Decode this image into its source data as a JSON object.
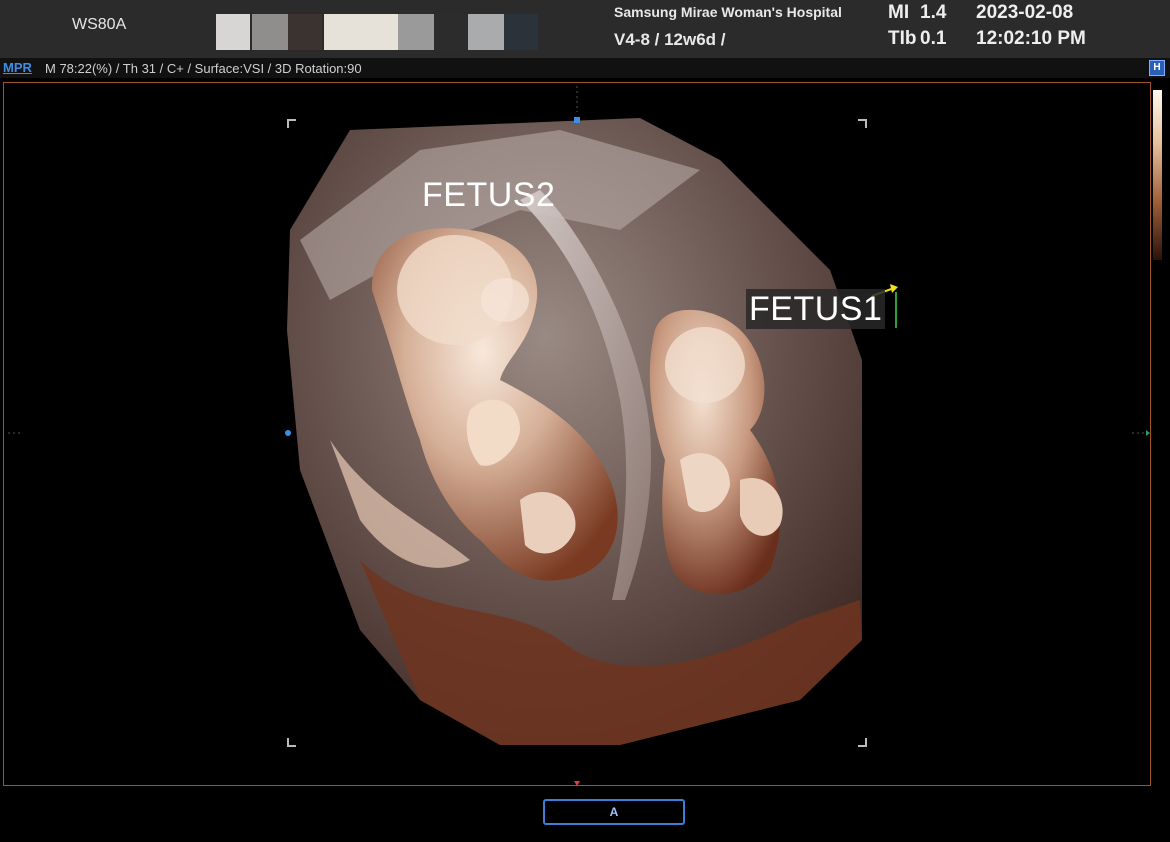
{
  "header": {
    "model": "WS80A",
    "hospital": "Samsung Mirae Woman's Hospital",
    "probe_info": "V4-8 / 12w6d /",
    "mi_label": "MI",
    "mi_value": "1.4",
    "tib_label": "TIb",
    "tib_value": "0.1",
    "date": "2023-02-08",
    "time": "12:02:10 PM"
  },
  "toolbar": {
    "mode_button": "MPR",
    "params": "M 78:22(%) / Th 31 / C+ / Surface:VSI / 3D Rotation:90",
    "hide_button": "H"
  },
  "image": {
    "labels": {
      "fetus2": "FETUS2",
      "fetus1": "FETUS1"
    }
  },
  "footer": {
    "view_button": "A"
  },
  "colors": {
    "accent": "#3d8ee8",
    "frame": "#a0522d",
    "tissue_light": "#f2dccb",
    "tissue_dark": "#7a3a22"
  }
}
